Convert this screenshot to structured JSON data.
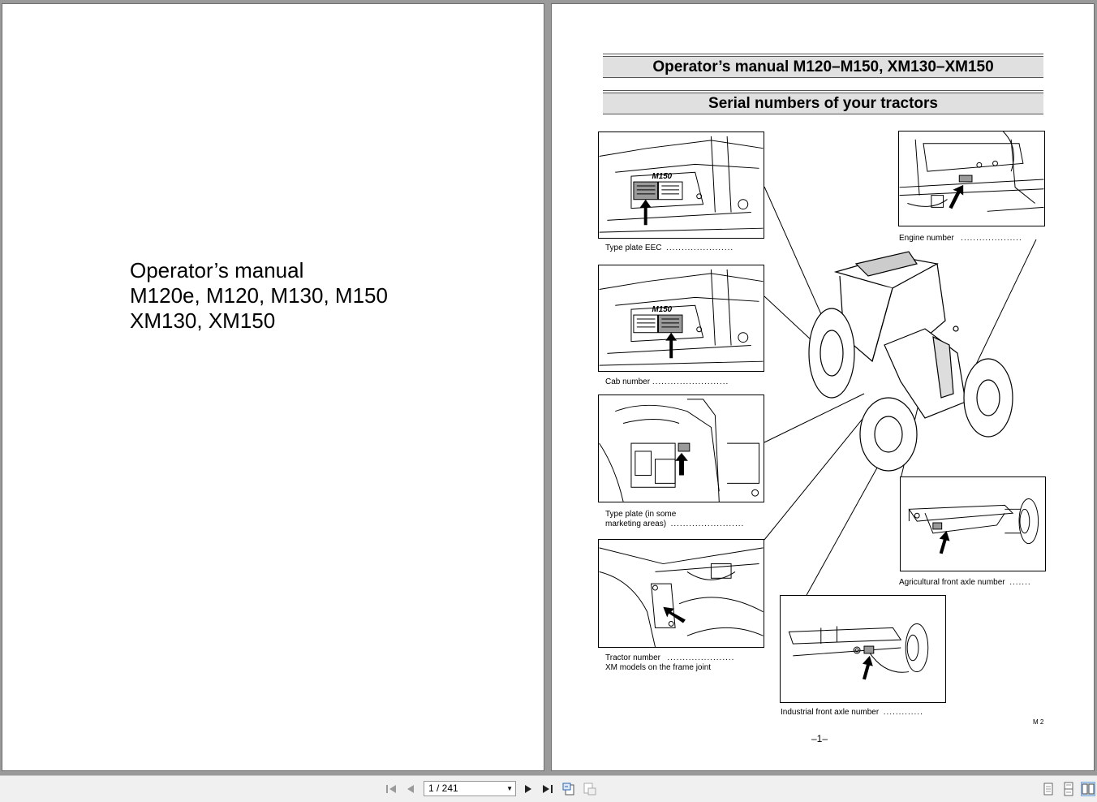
{
  "cover": {
    "line1": "Operator’s manual",
    "line2": "M120e, M120, M130, M150",
    "line3": "XM130, XM150"
  },
  "header": {
    "title": "Operator’s manual M120–M150, XM130–XM150",
    "subtitle": "Serial numbers of your tractors"
  },
  "figures": {
    "type_plate_eec": {
      "caption": "Type plate EEC",
      "dots": "......................",
      "badge": "M150"
    },
    "cab_number": {
      "caption": "Cab number",
      "dots": ".........................",
      "badge": "M150"
    },
    "type_plate_some": {
      "caption_1": "Type plate (in some",
      "caption_2": "marketing areas)",
      "dots": "........................"
    },
    "tractor_number": {
      "caption_1": "Tractor number",
      "dots": "......................",
      "caption_2": "XM models on the frame joint"
    },
    "engine_number": {
      "caption": "Engine number",
      "dots": "...................."
    },
    "agri_axle": {
      "caption": "Agricultural front axle number",
      "dots": "......."
    },
    "industrial_axle": {
      "caption": "Industrial front axle number",
      "dots": "............."
    }
  },
  "footer": {
    "page_number": "–1–",
    "code": "M 2"
  },
  "toolbar": {
    "page_indicator": "1 / 241"
  }
}
